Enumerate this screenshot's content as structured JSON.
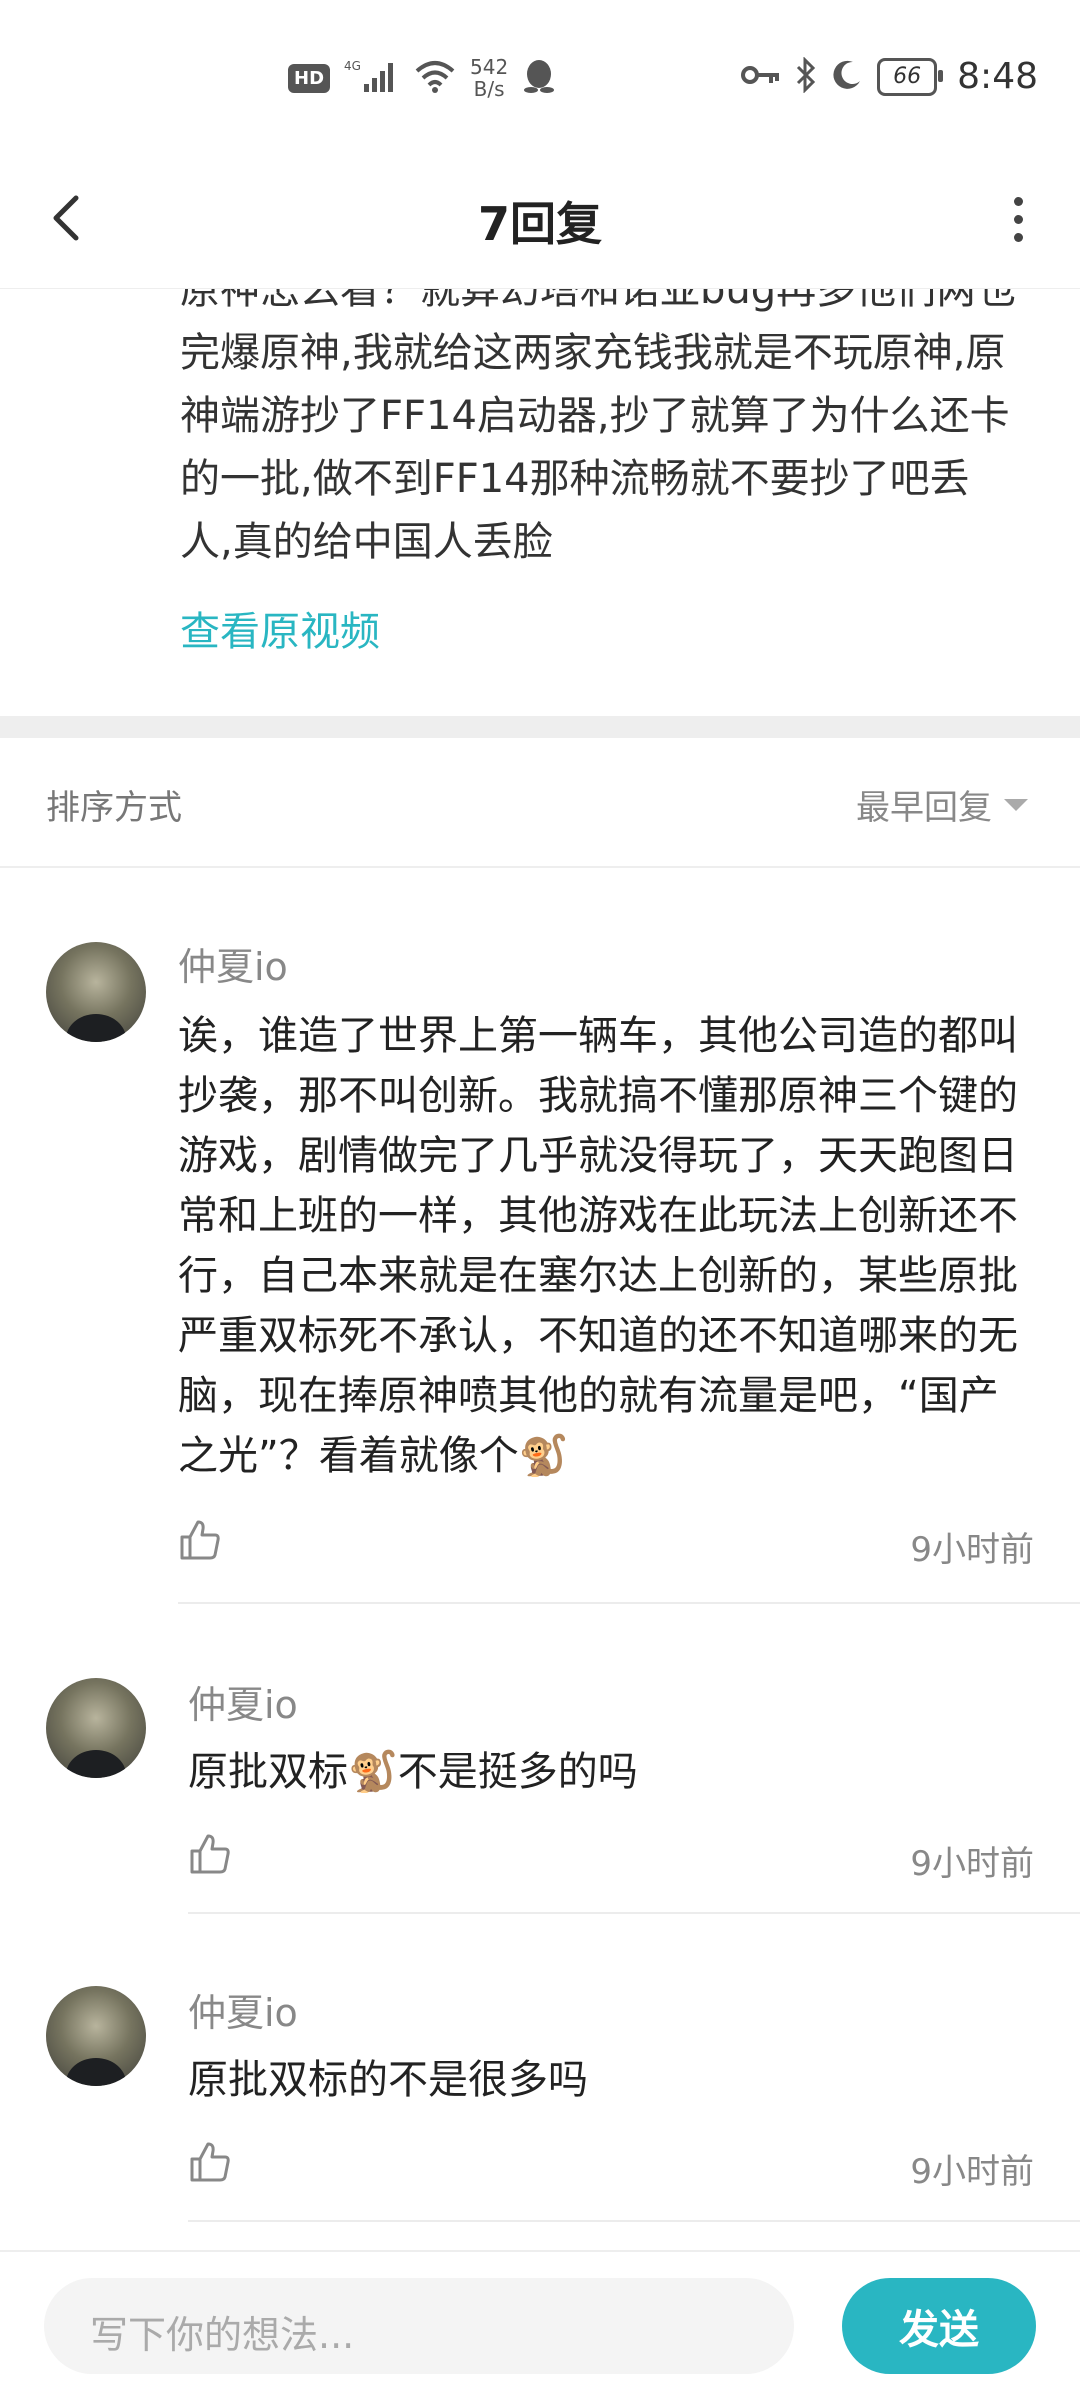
{
  "status_bar": {
    "hd": "HD",
    "network": "4G",
    "speed_value": "542",
    "speed_unit": "B/s",
    "battery": "66",
    "time": "8:48",
    "icons": [
      "signal-icon",
      "wifi-icon",
      "qq-icon",
      "key-icon",
      "bluetooth-icon",
      "moon-icon"
    ]
  },
  "nav": {
    "title": "7回复"
  },
  "post": {
    "text": "原神怎么看？就算幻塔和诺亚bug再多他们两也完爆原神,我就给这两家充钱我就是不玩原神,原神端游抄了FF14启动器,抄了就算了为什么还卡的一批,做不到FF14那种流畅就不要抄了吧丢人,真的给中国人丢脸",
    "view_original": "查看原视频"
  },
  "sort": {
    "label": "排序方式",
    "value": "最早回复"
  },
  "comments": [
    {
      "username": "仲夏io",
      "content": "诶，谁造了世界上第一辆车，其他公司造的都叫抄袭，那不叫创新。我就搞不懂那原神三个键的游戏，剧情做完了几乎就没得玩了，天天跑图日常和上班的一样，其他游戏在此玩法上创新还不行，自己本来就是在塞尔达上创新的，某些原批严重双标死不承认，不知道的还不知道哪来的无脑，现在捧原神喷其他的就有流量是吧，“国产之光”？看着就像个🐒",
      "time": "9小时前"
    },
    {
      "username": "仲夏io",
      "content": "原批双标🐒不是挺多的吗",
      "time": "9小时前"
    },
    {
      "username": "仲夏io",
      "content": "原批双标的不是很多吗",
      "time": "9小时前"
    }
  ],
  "input": {
    "placeholder": "写下你的想法...",
    "send": "发送"
  },
  "colors": {
    "accent": "#29b6c2"
  }
}
